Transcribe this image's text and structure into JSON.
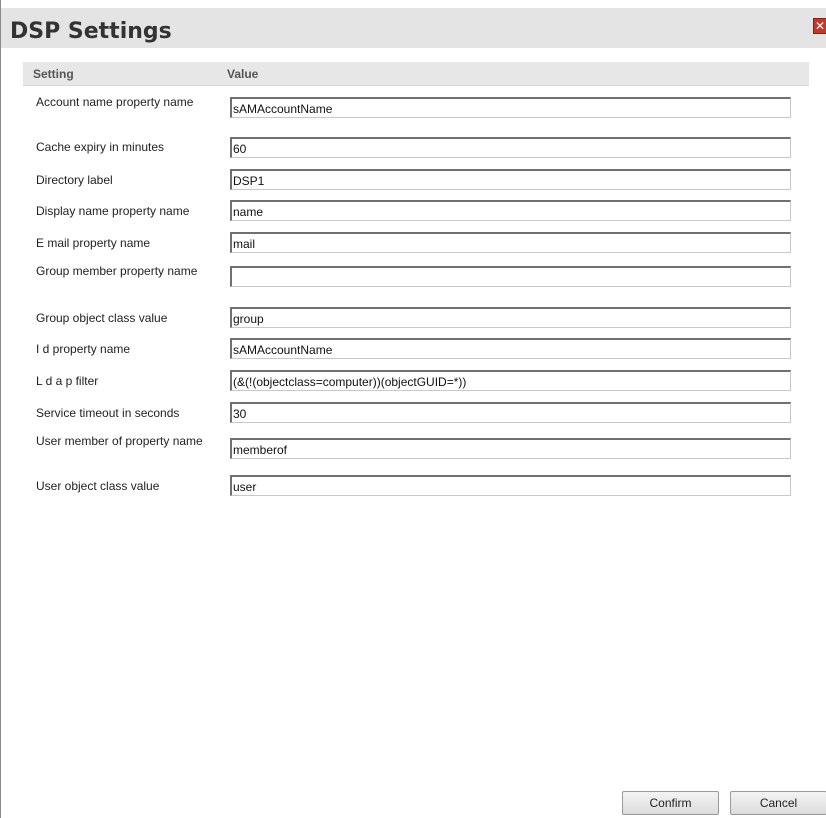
{
  "dialog": {
    "title": "DSP Settings",
    "close_label": "✕",
    "accent_color": "#c0392b"
  },
  "table": {
    "header_setting": "Setting",
    "header_value": "Value"
  },
  "rows": [
    {
      "label": "Account name property name",
      "value": "sAMAccountName"
    },
    {
      "label": "Cache expiry in minutes",
      "value": "60"
    },
    {
      "label": "Directory label",
      "value": "DSP1"
    },
    {
      "label": "Display name property name",
      "value": "name"
    },
    {
      "label": "E mail property name",
      "value": "mail"
    },
    {
      "label": "Group member property name",
      "value": ""
    },
    {
      "label": "Group object class value",
      "value": "group"
    },
    {
      "label": "I d property name",
      "value": "sAMAccountName"
    },
    {
      "label": "L d a p filter",
      "value": "(&(!(objectclass=computer))(objectGUID=*))"
    },
    {
      "label": "Service timeout in seconds",
      "value": "30"
    },
    {
      "label": "User member of property name",
      "value": "memberof"
    },
    {
      "label": "User object class value",
      "value": "user"
    }
  ],
  "buttons": {
    "confirm": "Confirm",
    "cancel": "Cancel"
  }
}
